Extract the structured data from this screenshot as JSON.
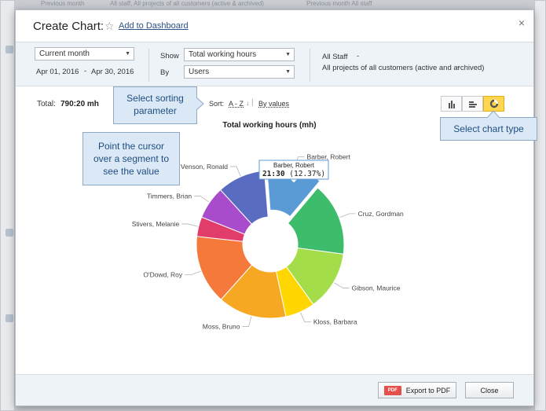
{
  "background": {
    "strip_left": "Previous month",
    "strip_mid": "All staff, All projects of all customers (active & archived)",
    "strip_right": "Previous month  All staff"
  },
  "dialog": {
    "title": "Create Chart:",
    "add_to_dashboard": "Add to Dashboard",
    "close_glyph": "×"
  },
  "filters": {
    "period": "Current month",
    "date_from": "Apr 01, 2016",
    "date_sep": "-",
    "date_to": "Apr 30, 2016",
    "show_label": "Show",
    "show_value": "Total working hours",
    "by_label": "By",
    "by_value": "Users",
    "staff": "All Staff",
    "staff_suffix": "-",
    "projects": "All projects of all customers (active and archived)",
    "projects_suffix": "-"
  },
  "summary": {
    "total_label": "Total:",
    "total_value": "790:20 mh"
  },
  "sort": {
    "label": "Sort:",
    "az": "A - Z",
    "arrow": "↓",
    "sep": "|",
    "by_values": "By values"
  },
  "chart_types": [
    "bar-chart-icon",
    "horizontal-bar-icon",
    "donut-chart-icon"
  ],
  "callouts": {
    "sorting": "Select sorting parameter",
    "chart_type": "Select chart type",
    "cursor": "Point the cursor over a segment to see the value"
  },
  "tooltip": {
    "name": "Barber, Robert",
    "value": "21:30",
    "percent": "(12.37%)"
  },
  "footer": {
    "export_icon": "PDF",
    "export_label": "Export to PDF",
    "close_label": "Close"
  },
  "chart_data": {
    "type": "pie",
    "title": "Total working hours (mh)",
    "donut": true,
    "highlighted": "Barber, Robert",
    "slices": [
      {
        "name": "Barber, Robert",
        "percent": 12.37,
        "color": "#5b9bd5"
      },
      {
        "name": "Cruz, Gordman",
        "percent": 16.0,
        "color": "#3dbd6b"
      },
      {
        "name": "Gibson, Maurice",
        "percent": 13.0,
        "color": "#a4dd4a"
      },
      {
        "name": "Kloss, Barbara",
        "percent": 6.5,
        "color": "#ffd600"
      },
      {
        "name": "Moss, Bruno",
        "percent": 15.0,
        "color": "#f7a823"
      },
      {
        "name": "O'Dowd, Roy",
        "percent": 15.13,
        "color": "#f5793a"
      },
      {
        "name": "Stivers, Melanie",
        "percent": 4.3,
        "color": "#e23d6a"
      },
      {
        "name": "Timmers, Brian",
        "percent": 7.2,
        "color": "#a94ccc"
      },
      {
        "name": "Venson, Ronald",
        "percent": 10.5,
        "color": "#5a6cc2"
      }
    ]
  }
}
